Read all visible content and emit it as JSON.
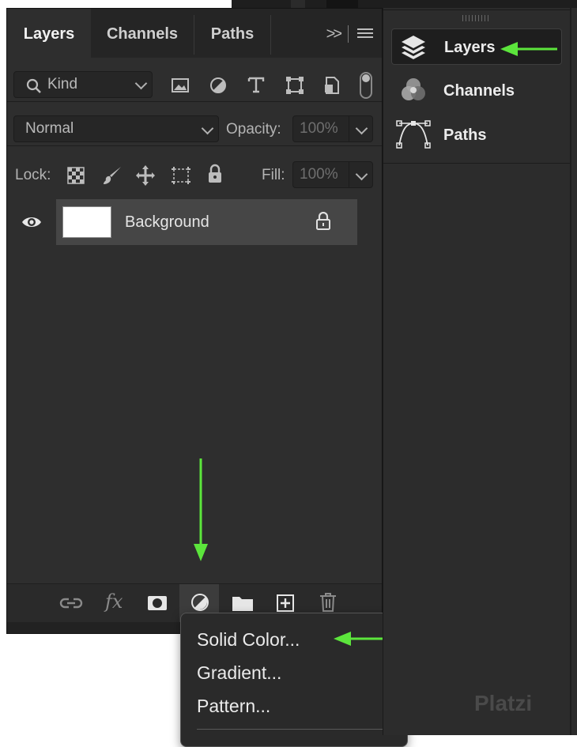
{
  "tabs": [
    {
      "label": "Layers",
      "active": true
    },
    {
      "label": "Channels",
      "active": false
    },
    {
      "label": "Paths",
      "active": false
    }
  ],
  "tab_tools": {
    "expand_glyph": ">>",
    "menu_icon": "hamburger-menu-icon"
  },
  "filter": {
    "kind_label": "Kind",
    "icons": [
      "pixel-layer-filter-icon",
      "adjustment-layer-filter-icon",
      "type-layer-filter-icon",
      "shape-layer-filter-icon",
      "smart-object-filter-icon"
    ]
  },
  "blend": {
    "mode": "Normal",
    "opacity_label": "Opacity:",
    "opacity_value": "100%"
  },
  "lock": {
    "label": "Lock:",
    "icons": [
      "lock-transparent-pixels-icon",
      "lock-image-pixels-icon",
      "lock-position-icon",
      "lock-artboard-icon",
      "lock-all-icon"
    ],
    "fill_label": "Fill:",
    "fill_value": "100%"
  },
  "layers": [
    {
      "name": "Background",
      "visible": true,
      "locked": true
    }
  ],
  "bottom_toolbar": {
    "fx_label": "fx",
    "icons": [
      "link-layers-icon",
      "layer-style-icon",
      "add-mask-icon",
      "new-fill-adjustment-layer-icon",
      "new-group-icon",
      "new-layer-icon",
      "delete-layer-icon"
    ]
  },
  "fill_menu": {
    "items": [
      "Solid Color...",
      "Gradient...",
      "Pattern..."
    ]
  },
  "side_panel": {
    "items": [
      {
        "label": "Layers",
        "icon": "layers-stack-icon",
        "active": true
      },
      {
        "label": "Channels",
        "icon": "channels-icon",
        "active": false
      },
      {
        "label": "Paths",
        "icon": "paths-icon",
        "active": false
      }
    ]
  },
  "watermark": "Platzi",
  "colors": {
    "annotation_arrow": "#5ce53c",
    "panel_bg": "#2e2e2e",
    "selected_layer": "#464646"
  }
}
